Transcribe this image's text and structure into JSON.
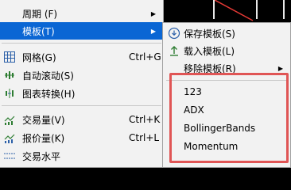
{
  "main_menu": {
    "items": [
      {
        "label": "周期 (F)"
      },
      {
        "label": "模板(T)"
      },
      {
        "label": "网格(G)",
        "shortcut": "Ctrl+G"
      },
      {
        "label": "自动滚动(S)"
      },
      {
        "label": "图表转换(H)"
      },
      {
        "label": "交易量(V)",
        "shortcut": "Ctrl+K"
      },
      {
        "label": "报价量(K)",
        "shortcut": "Ctrl+L"
      },
      {
        "label": "交易水平"
      }
    ]
  },
  "template_menu": {
    "items": [
      {
        "label": "保存模板(S)"
      },
      {
        "label": "载入模板(L)"
      },
      {
        "label": "移除模板(R)"
      }
    ],
    "templates": [
      "123",
      "ADX",
      "BollingerBands",
      "Momentum"
    ]
  },
  "colors": {
    "highlight": "#0a66d4",
    "menu_bg": "#f2f2f2",
    "callout": "#e05555"
  }
}
